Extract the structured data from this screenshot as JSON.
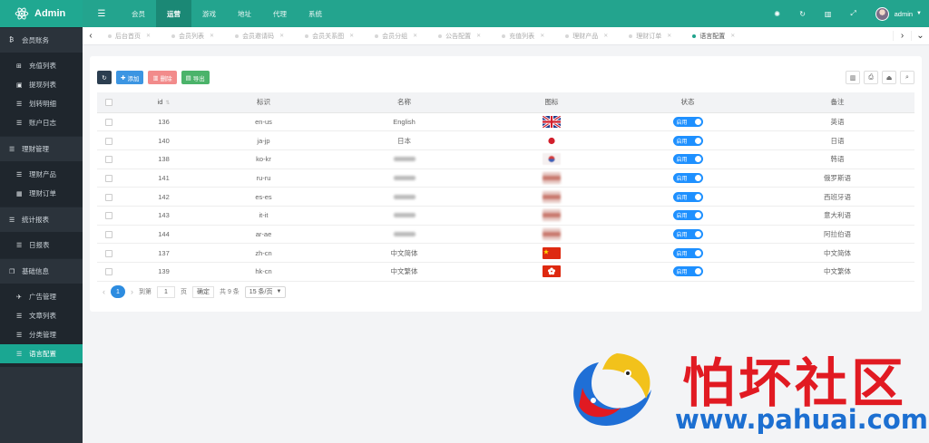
{
  "app": {
    "title": "Admin"
  },
  "sidebar": {
    "groups": [
      {
        "label": "会员账务",
        "items": [
          "充值列表",
          "提现列表",
          "划转明细",
          "账户日志"
        ]
      },
      {
        "label": "理财管理",
        "items": [
          "理财产品",
          "理财订单"
        ]
      },
      {
        "label": "统计报表",
        "items": [
          "日报表"
        ]
      },
      {
        "label": "基础信息",
        "items": [
          "广告管理",
          "文章列表",
          "分类管理",
          "语言配置"
        ]
      }
    ],
    "active_item": "语言配置"
  },
  "topbar": {
    "menu": [
      "会员",
      "运营",
      "游戏",
      "地址",
      "代理",
      "系统"
    ],
    "active_menu": "运营",
    "user": "admin"
  },
  "tabs": {
    "items": [
      "后台首页",
      "会员列表",
      "会员邀请码",
      "会员关系图",
      "会员分组",
      "公告配置",
      "充值列表",
      "理财产品",
      "理财订单",
      "语言配置"
    ],
    "active": "语言配置"
  },
  "toolbar": {
    "add_label": "添加",
    "delete_label": "删除",
    "export_label": "导出"
  },
  "table": {
    "columns": [
      "id",
      "标识",
      "名称",
      "图标",
      "状态",
      "备注"
    ],
    "status_label": "启用",
    "rows": [
      {
        "id": "136",
        "code": "en-us",
        "name": "English",
        "flag": "uk",
        "remark": "英语"
      },
      {
        "id": "140",
        "code": "ja-jp",
        "name": "日本",
        "flag": "jp",
        "remark": "日语"
      },
      {
        "id": "138",
        "code": "ko-kr",
        "name": "",
        "flag": "kr",
        "remark": "韩语"
      },
      {
        "id": "141",
        "code": "ru-ru",
        "name": "",
        "flag": "blur",
        "remark": "俄罗斯语"
      },
      {
        "id": "142",
        "code": "es-es",
        "name": "",
        "flag": "blur",
        "remark": "西班牙语"
      },
      {
        "id": "143",
        "code": "it-it",
        "name": "",
        "flag": "blur",
        "remark": "意大利语"
      },
      {
        "id": "144",
        "code": "ar-ae",
        "name": "",
        "flag": "blur",
        "remark": "阿拉伯语"
      },
      {
        "id": "137",
        "code": "zh-cn",
        "name": "中文简体",
        "flag": "cn",
        "remark": "中文简体"
      },
      {
        "id": "139",
        "code": "hk-cn",
        "name": "中文繁体",
        "flag": "hk",
        "remark": "中文繁体"
      }
    ]
  },
  "pager": {
    "current": "1",
    "goto_label": "到第",
    "goto_value": "1",
    "page_unit": "页",
    "confirm_label": "确定",
    "total_label": "共 9 条",
    "page_size": "15 条/页"
  },
  "watermark": {
    "title": "怕坏社区",
    "url": "www.pahuai.com"
  },
  "colors": {
    "brand": "#23a48e",
    "sidebar": "#2b333b",
    "active": "#1aa792",
    "switch": "#1e90ff"
  }
}
